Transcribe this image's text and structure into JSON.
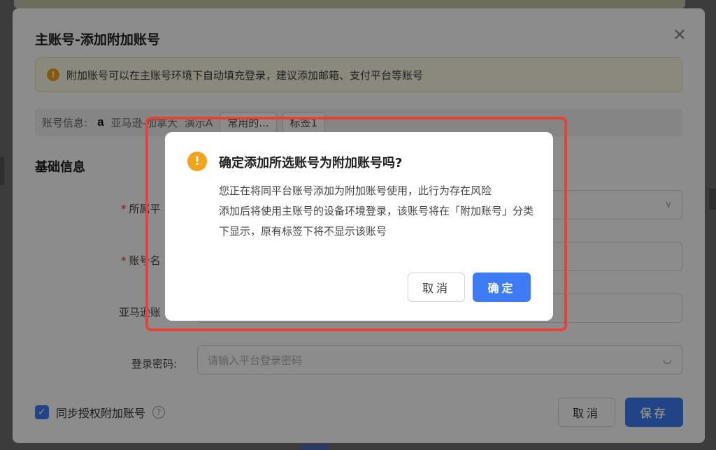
{
  "main_dialog": {
    "title": "主账号-添加附加账号",
    "notice": "附加账号可以在主账号环境下自动填充登录，建议添加邮箱、支付平台等账号",
    "account_bar": {
      "label": "账号信息:",
      "icon_letter": "a",
      "platform": "亚马逊-加拿大",
      "name": "演示A",
      "tags": [
        "常用的...",
        "标签1"
      ]
    },
    "section_title": "基础信息",
    "fields": {
      "platform_label": "所属平",
      "account_name_label": "账号名",
      "amazon_label": "亚马逊账",
      "password_label": "登录密码:",
      "password_placeholder": "请输入平台登录密码"
    },
    "sync_checkbox_label": "同步授权附加账号",
    "cancel_label": "取消",
    "save_label": "保存"
  },
  "confirm_dialog": {
    "title": "确定添加所选账号为附加账号吗?",
    "body_line1": "您正在将同平台账号添加为附加账号使用，此行为存在风险",
    "body_line2": "添加后将使用主账号的设备环境登录，该账号将在「附加账号」分类下显示，原有标签下将不显示该账号",
    "cancel_label": "取消",
    "ok_label": "确定"
  },
  "colors": {
    "primary": "#3d7cf5",
    "warning": "#f3a31b",
    "highlight": "#e6423a"
  }
}
